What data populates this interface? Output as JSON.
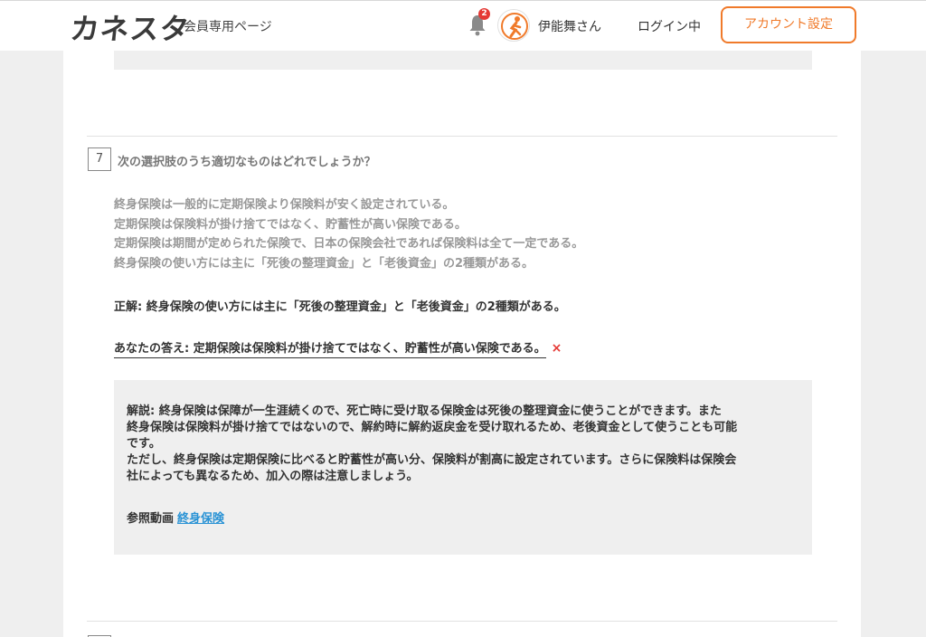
{
  "header": {
    "logo": "カネスタ",
    "subtitle": "会員専用ページ",
    "notification_count": "2",
    "user_name": "伊能舞さん",
    "login_status": "ログイン中",
    "account_button": "アカウント設定"
  },
  "question": {
    "number": "7",
    "text": "次の選択肢のうち適切なものはどれでしょうか？",
    "choices": [
      "終身保険は一般的に定期保険より保険料が安く設定されている。",
      "定期保険は保険料が掛け捨てではなく、貯蓄性が高い保険である。",
      "定期保険は期間が定められた保険で、日本の保険会社であれば保険料は全て一定である。",
      "終身保険の使い方には主に「死後の整理資金」と「老後資金」の2種類がある。"
    ],
    "correct_label": "正解: 終身保険の使い方には主に「死後の整理資金」と「老後資金」の2種類がある。",
    "your_answer_label": "あなたの答え: 定期保険は保険料が掛け捨てではなく、貯蓄性が高い保険である。",
    "wrong_mark": "×",
    "explanation": [
      "解説: 終身保険は保障が一生涯続くので、死亡時に受け取る保険金は死後の整理資金に使うことができます。また",
      "終身保険は保険料が掛け捨てではないので、解約時に解約返戻金を受け取れるため、老後資金として使うことも可能",
      "です。",
      "ただし、終身保険は定期保険に比べると貯蓄性が高い分、保険料が割高に設定されています。さらに保険料は保険会",
      "社によっても異なるため、加入の際は注意しましょう。"
    ],
    "reference_label": "参照動画",
    "reference_link": "終身保険"
  },
  "colors": {
    "accent": "#f07a2a",
    "link": "#2a93d5",
    "badge": "#e53935",
    "background": "#efefef"
  }
}
